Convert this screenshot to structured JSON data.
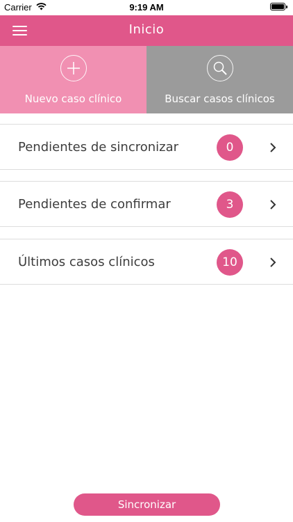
{
  "status_bar": {
    "carrier": "Carrier",
    "time": "9:19 AM",
    "wifi_icon": "wifi-icon",
    "battery_icon": "battery-icon"
  },
  "nav": {
    "title": "Inicio",
    "menu_icon": "hamburger-menu-icon"
  },
  "tiles": {
    "new_case": {
      "label": "Nuevo caso clínico",
      "icon": "plus-icon"
    },
    "search_cases": {
      "label": "Buscar casos clínicos",
      "icon": "search-icon"
    }
  },
  "list": [
    {
      "label": "Pendientes de sincronizar",
      "count": "0"
    },
    {
      "label": "Pendientes de confirmar",
      "count": "3"
    },
    {
      "label": "Últimos casos clínicos",
      "count": "10"
    }
  ],
  "footer": {
    "sync_label": "Sincronizar"
  },
  "colors": {
    "accent": "#e0578a",
    "tile_new": "#f190b2",
    "tile_search": "#9b9b9b"
  }
}
